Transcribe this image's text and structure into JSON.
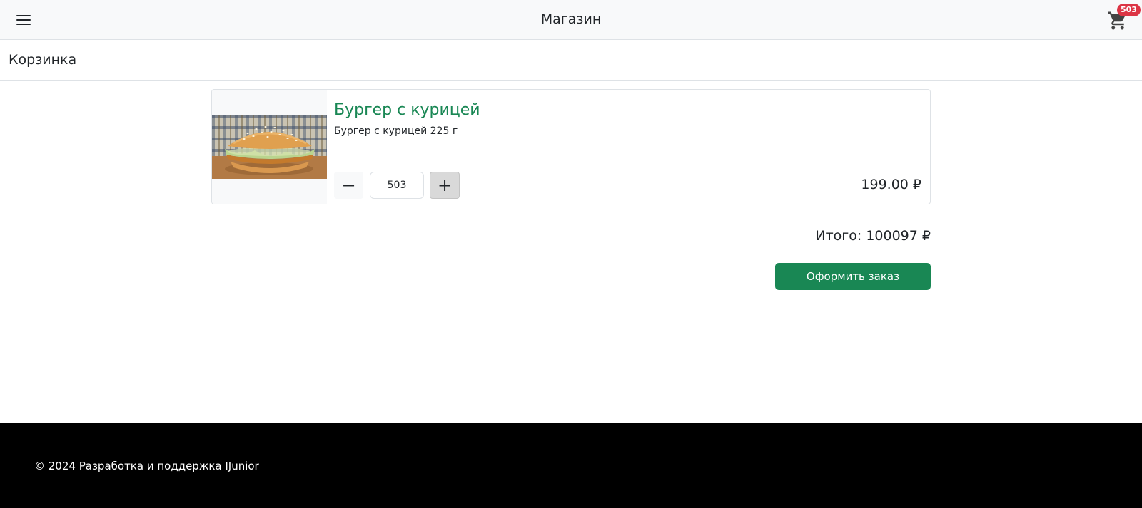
{
  "header": {
    "brand": "Магазин",
    "cart_count": "503",
    "menu_icon": "hamburger-menu-icon",
    "cart_icon": "shopping-cart-icon"
  },
  "page": {
    "title": "Корзинка"
  },
  "cart": {
    "items": [
      {
        "name": "Бургер с курицей",
        "description": "Бургер с курицей 225 г",
        "quantity": "503",
        "price": "199.00 ₽",
        "minus_label": "−",
        "plus_label": "+"
      }
    ],
    "total": "Итого: 100097 ₽",
    "checkout_label": "Оформить заказ"
  },
  "footer": {
    "text": "© 2024 Разработка и поддержка IJunior"
  },
  "colors": {
    "accent": "#198754",
    "badge": "#dc3545",
    "navbar": "#f8f9fa",
    "footer": "#000000"
  }
}
